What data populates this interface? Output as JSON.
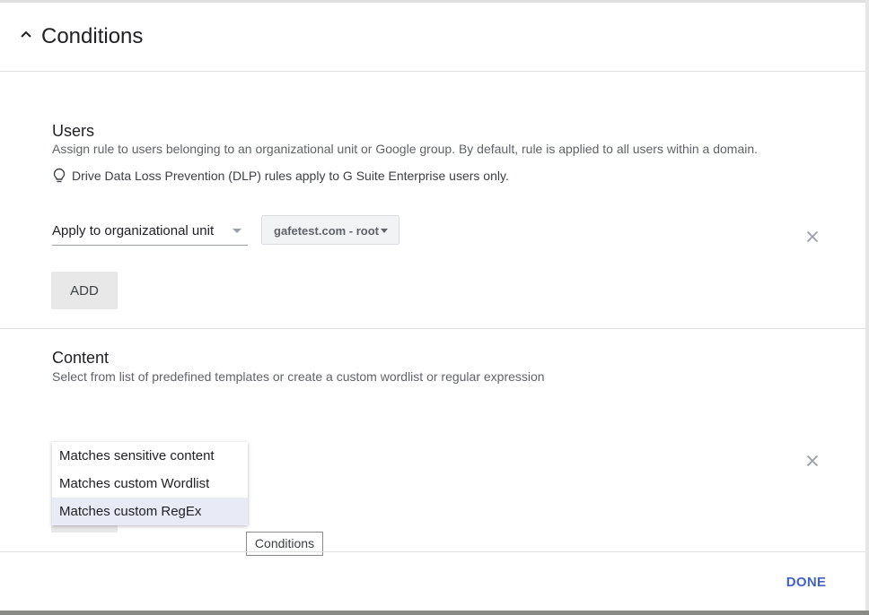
{
  "header": {
    "title": "Conditions"
  },
  "users": {
    "title": "Users",
    "description": "Assign rule to users belonging to an organizational unit or Google group. By default, rule is applied to all users within a domain.",
    "note": "Drive Data Loss Prevention (DLP) rules apply to G Suite Enterprise users only.",
    "scope_select": "Apply to organizational unit",
    "org_unit": "gafetest.com - root",
    "add_label": "ADD"
  },
  "content": {
    "title": "Content",
    "description": "Select from list of predefined templates or create a custom wordlist or regular expression",
    "menu_items": [
      {
        "label": "Matches sensitive content"
      },
      {
        "label": "Matches custom Wordlist"
      },
      {
        "label": "Matches custom RegEx"
      }
    ]
  },
  "tooltip": "Conditions",
  "footer": {
    "done_label": "DONE"
  }
}
